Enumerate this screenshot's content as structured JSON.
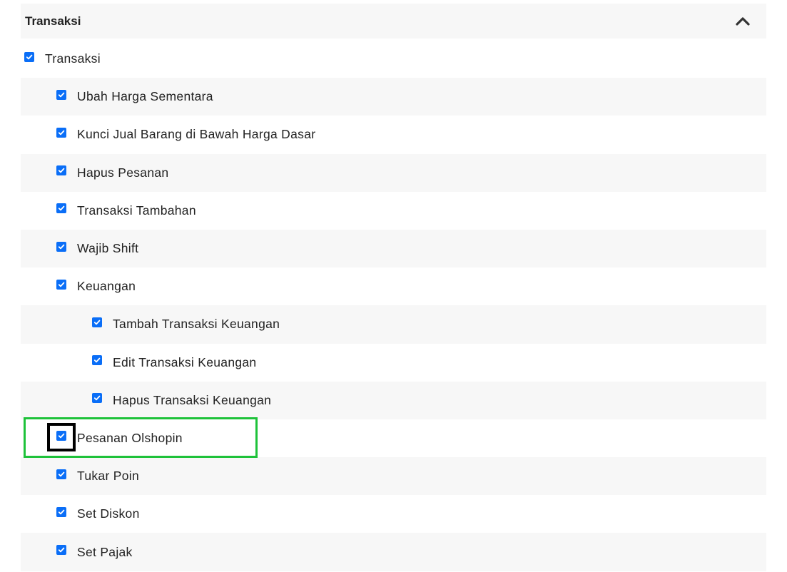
{
  "section": {
    "title": "Transaksi",
    "collapse_icon": "chevron-up-icon"
  },
  "accent_color": "#0a6ef7",
  "highlight_color": "#1ec23a",
  "permissions": [
    {
      "label": "Transaksi",
      "level": 0,
      "checked": true
    },
    {
      "label": "Ubah Harga Sementara",
      "level": 1,
      "checked": true
    },
    {
      "label": "Kunci Jual Barang di Bawah Harga Dasar",
      "level": 1,
      "checked": true
    },
    {
      "label": "Hapus Pesanan",
      "level": 1,
      "checked": true
    },
    {
      "label": "Transaksi Tambahan",
      "level": 1,
      "checked": true
    },
    {
      "label": "Wajib Shift",
      "level": 1,
      "checked": true
    },
    {
      "label": "Keuangan",
      "level": 1,
      "checked": true
    },
    {
      "label": "Tambah Transaksi Keuangan",
      "level": 2,
      "checked": true
    },
    {
      "label": "Edit Transaksi Keuangan",
      "level": 2,
      "checked": true
    },
    {
      "label": "Hapus Transaksi Keuangan",
      "level": 2,
      "checked": true
    },
    {
      "label": "Pesanan Olshopin",
      "level": 1,
      "checked": true
    },
    {
      "label": "Tukar Poin",
      "level": 1,
      "checked": true
    },
    {
      "label": "Set Diskon",
      "level": 1,
      "checked": true
    },
    {
      "label": "Set Pajak",
      "level": 1,
      "checked": true
    }
  ]
}
